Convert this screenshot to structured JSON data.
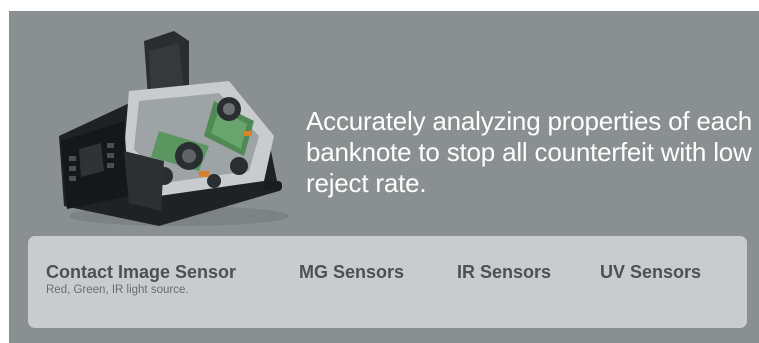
{
  "hero": {
    "headline": "Accurately analyzing properties of each banknote to stop all counterfeit with low reject rate."
  },
  "features": {
    "items": [
      {
        "title": "Contact Image Sensor",
        "subtitle": "Red, Green, IR light source."
      },
      {
        "title": "MG Sensors"
      },
      {
        "title": "IR Sensors"
      },
      {
        "title": "UV Sensors"
      }
    ]
  },
  "colors": {
    "panel_background": "#8a8f92",
    "feature_bar_background": "#c9cbcc",
    "feature_title": "#4d5154",
    "headline_text": "#ffffff"
  },
  "icons": {
    "product_image": "banknote-counter-cutaway-image"
  }
}
